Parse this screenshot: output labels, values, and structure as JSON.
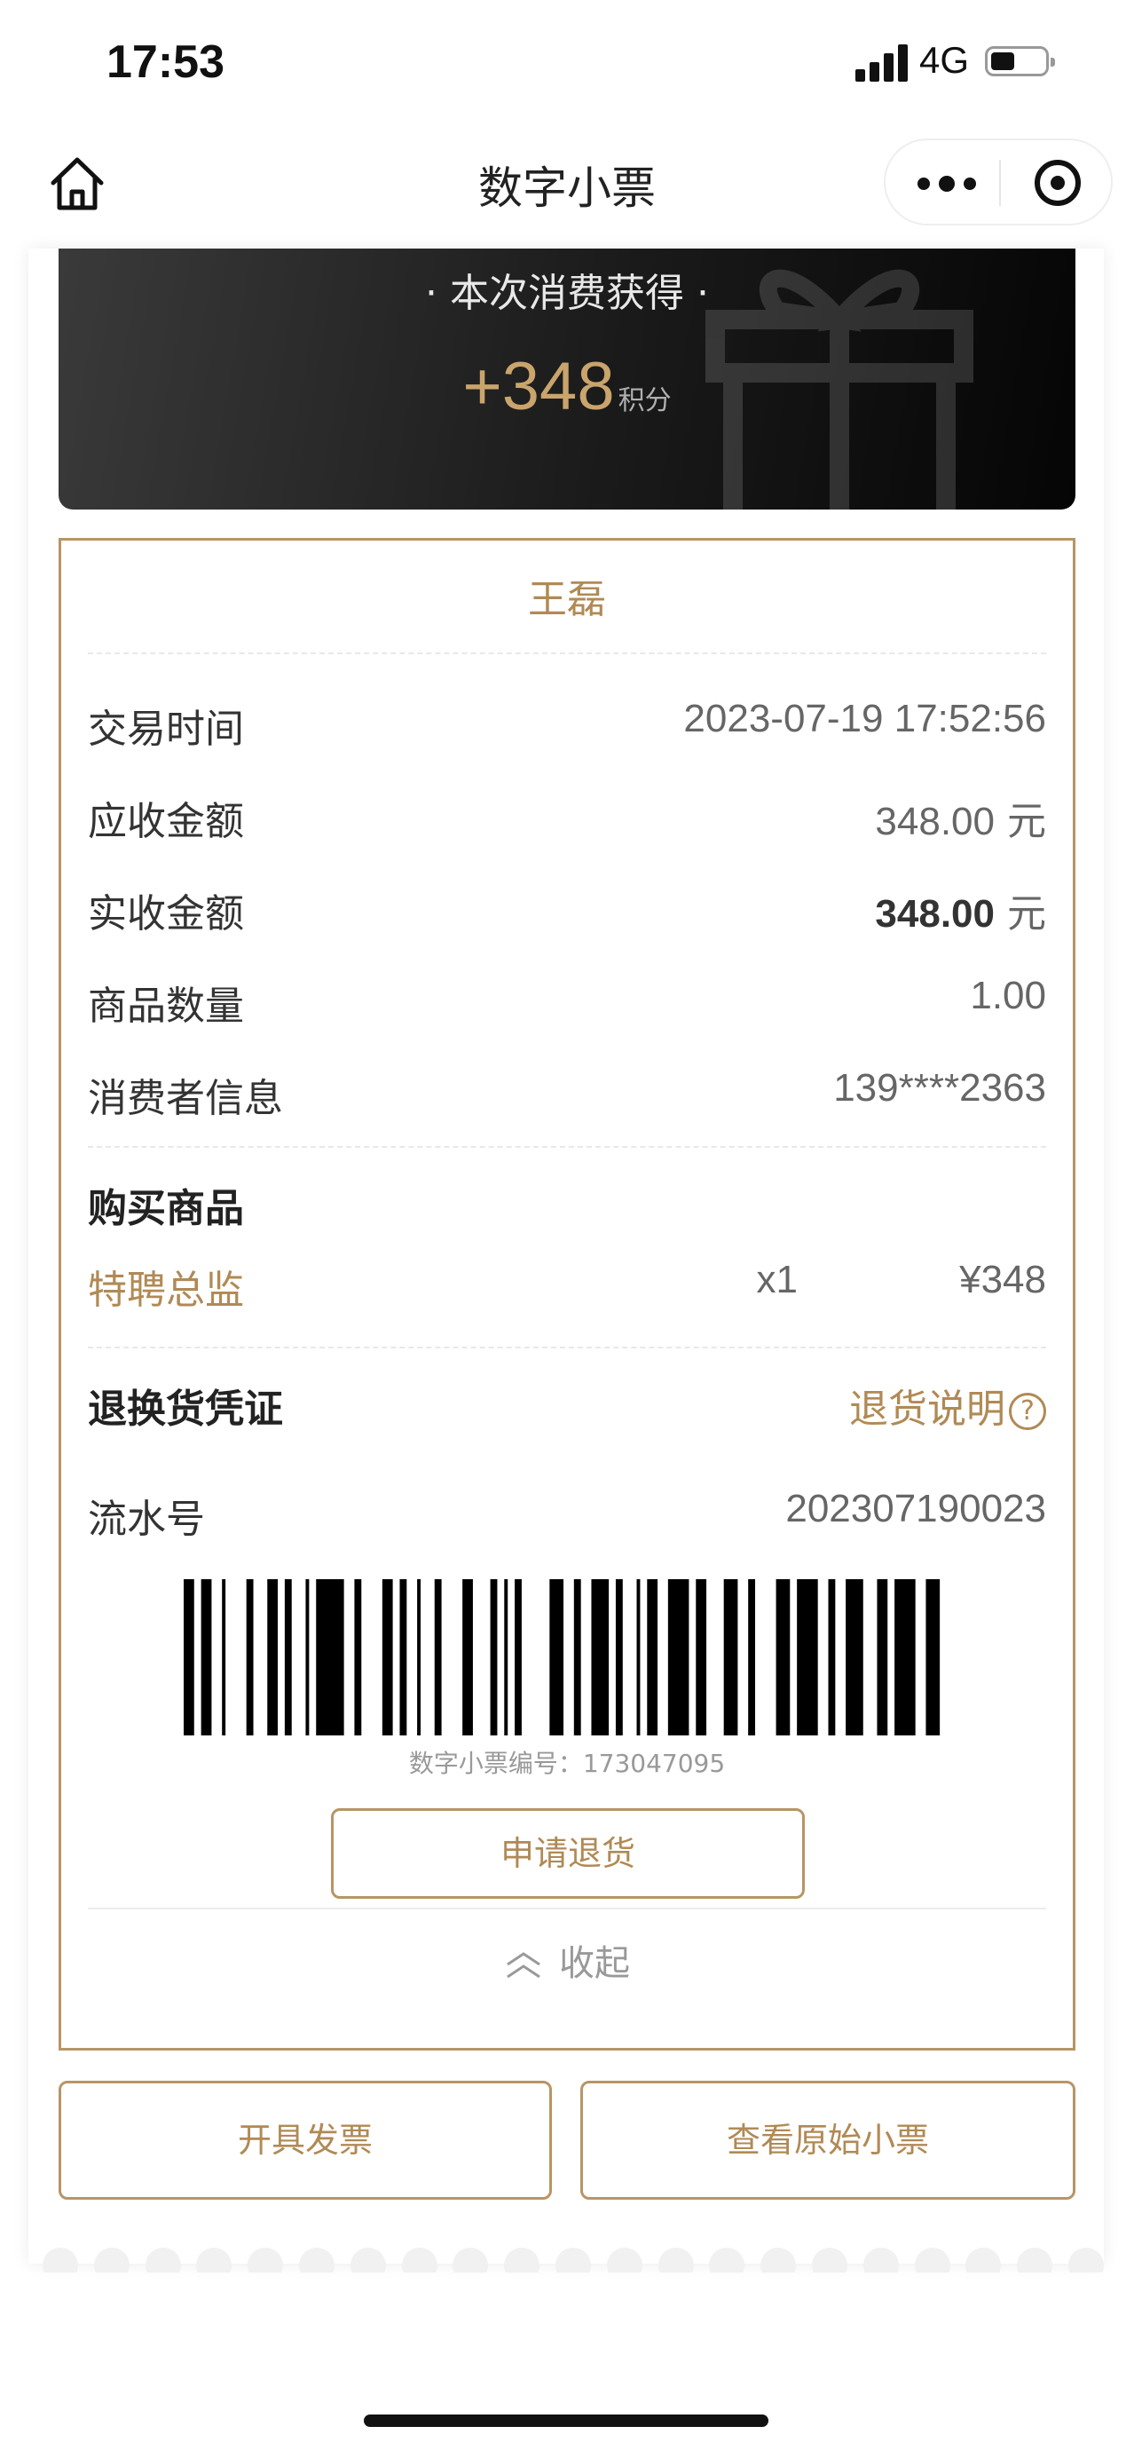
{
  "status_bar": {
    "time": "17:53",
    "network": "4G",
    "battery_percent": 40
  },
  "nav": {
    "title": "数字小票"
  },
  "banner": {
    "title": "· 本次消费获得 ·",
    "points": "+348",
    "points_unit": "积分"
  },
  "receipt": {
    "customer_name": "王磊",
    "rows": [
      {
        "label": "交易时间",
        "value": "2023-07-19 17:52:56",
        "unit": ""
      },
      {
        "label": "应收金额",
        "value": "348.00",
        "unit": " 元"
      },
      {
        "label": "实收金额",
        "value": "348.00",
        "unit": " 元"
      },
      {
        "label": "商品数量",
        "value": "1.00",
        "unit": ""
      },
      {
        "label": "消费者信息",
        "value": "139****2363",
        "unit": ""
      }
    ],
    "purchase": {
      "title": "购买商品",
      "items": [
        {
          "name": "特聘总监",
          "qty": "x1",
          "price": "¥348"
        }
      ]
    },
    "return_voucher": {
      "title": "退换货凭证",
      "help_link": "退货说明",
      "help_icon": "?",
      "serial_label": "流水号",
      "serial_value": "202307190023",
      "barcode_caption": "数字小票编号：173047095",
      "apply_return": "申请退货"
    },
    "collapse_label": "收起"
  },
  "actions": {
    "invoice": "开具发票",
    "view_original": "查看原始小票"
  },
  "colors": {
    "accent_gold": "#b08a55",
    "border_gold": "#b89565",
    "banner_dark": "#1a1a1a"
  }
}
